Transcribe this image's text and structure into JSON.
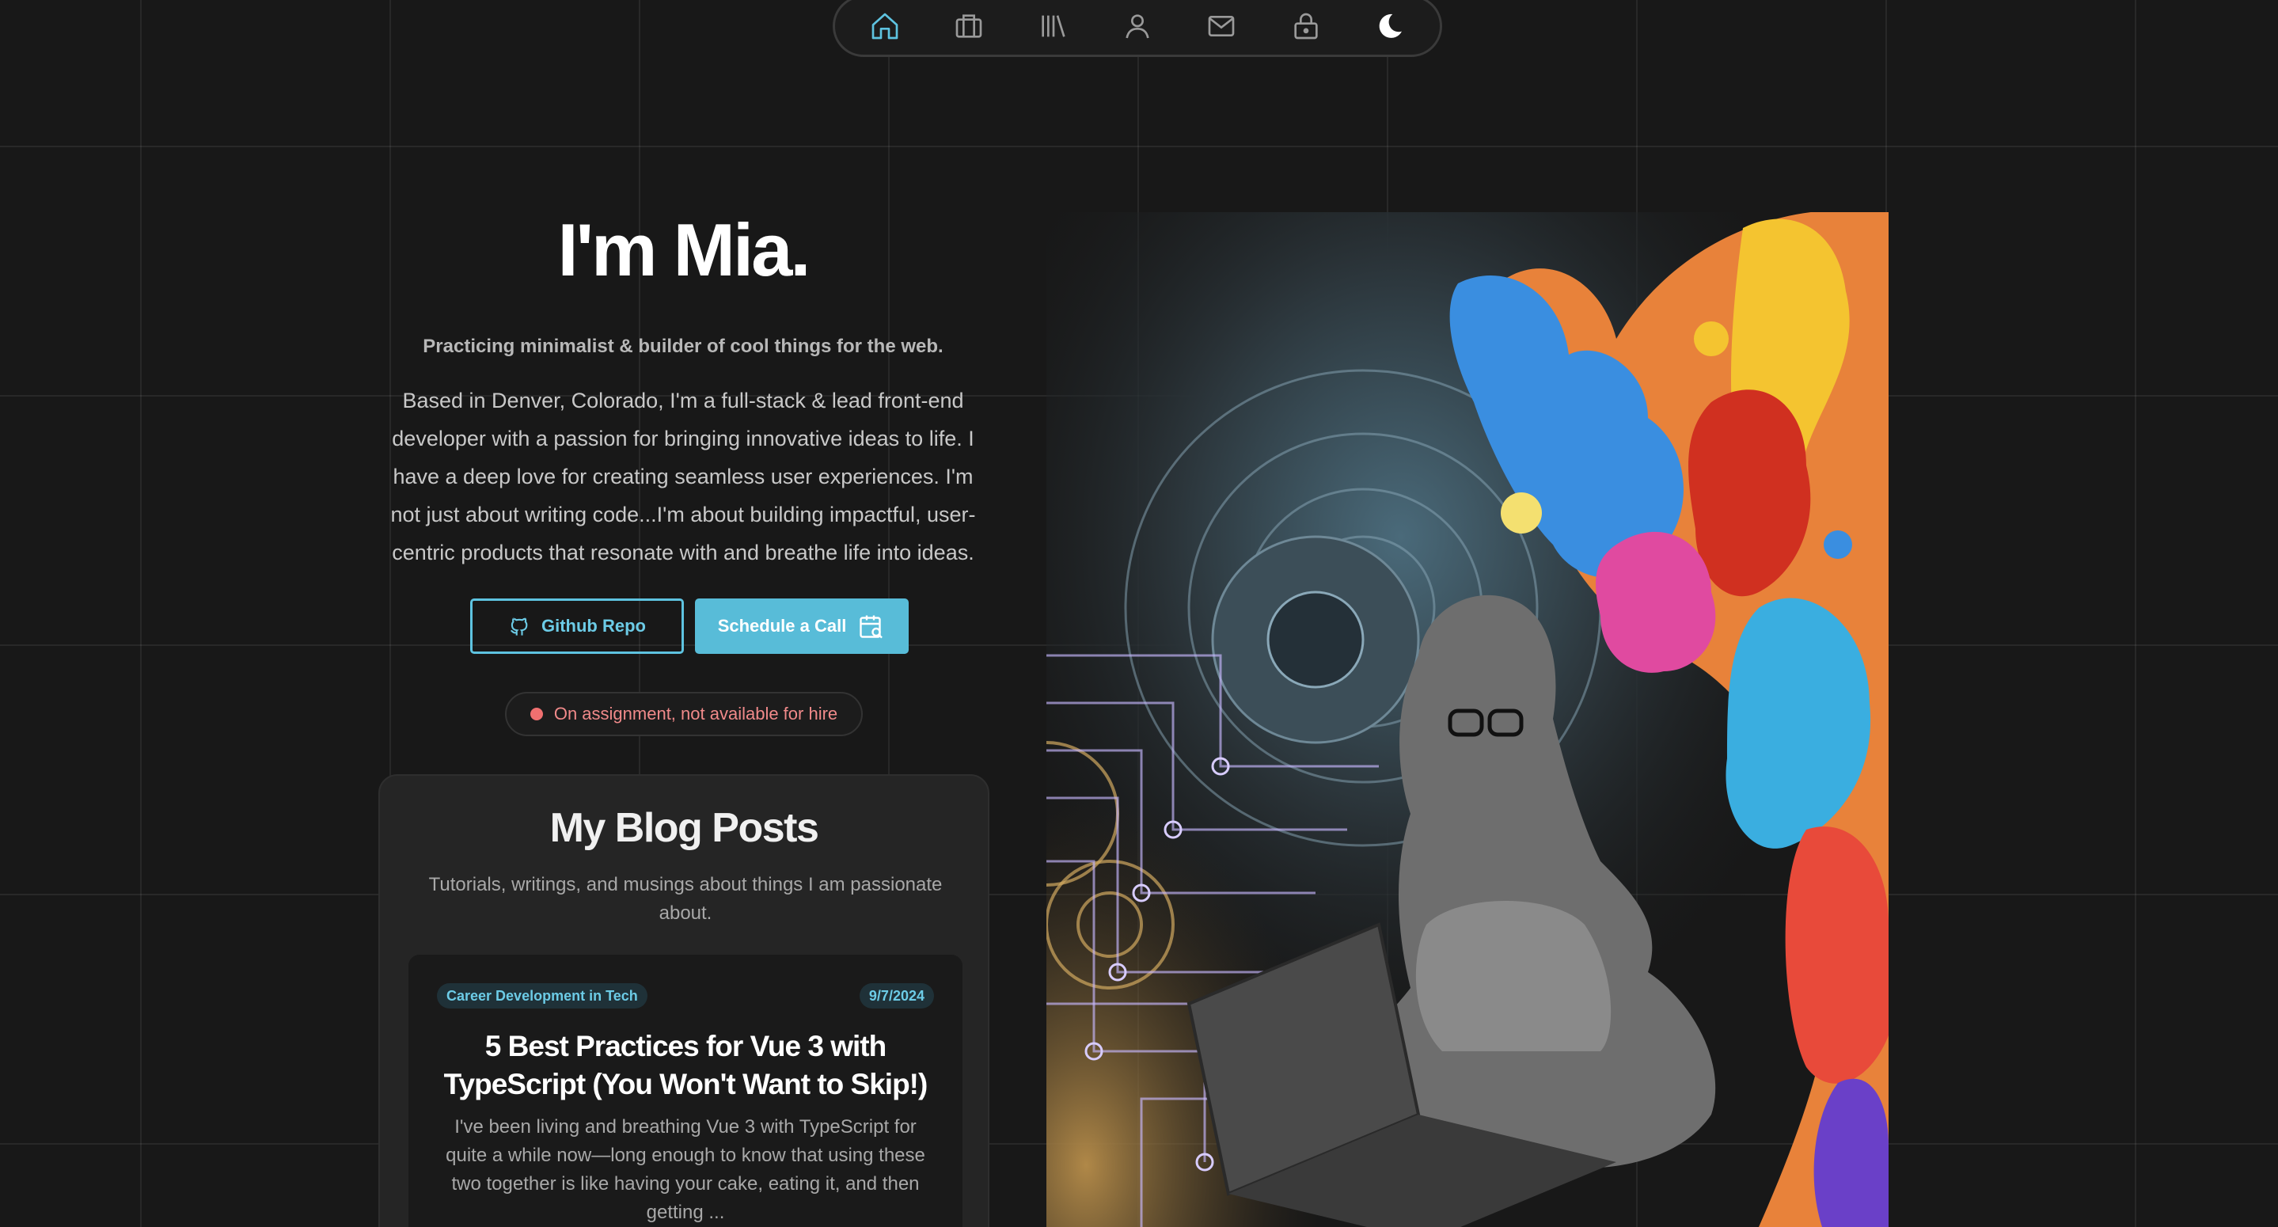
{
  "nav": {
    "items": [
      {
        "name": "home",
        "icon": "home-icon",
        "active": true
      },
      {
        "name": "portfolio",
        "icon": "briefcase-icon"
      },
      {
        "name": "library",
        "icon": "library-icon"
      },
      {
        "name": "about",
        "icon": "user-icon"
      },
      {
        "name": "contact",
        "icon": "mail-icon"
      },
      {
        "name": "private",
        "icon": "lock-icon"
      },
      {
        "name": "theme",
        "icon": "moon-icon"
      }
    ]
  },
  "hero": {
    "title": "I'm Mia.",
    "tagline": "Practicing minimalist & builder of cool things for the web.",
    "bio": "Based in Denver, Colorado, I'm a full-stack & lead front-end developer with a passion for bringing innovative ideas to life. I have a deep love for creating seamless user experiences. I'm not just about writing code...I'm about building impactful, user-centric products that resonate with and breathe life into ideas.",
    "github_label": "Github Repo",
    "schedule_label": "Schedule a Call",
    "status_text": "On assignment, not available for hire"
  },
  "blog": {
    "title": "My Blog Posts",
    "subtitle": "Tutorials, writings, and musings about things I am passionate about.",
    "posts": [
      {
        "category": "Career Development in Tech",
        "date": "9/7/2024",
        "title": "5 Best Practices for Vue 3 with TypeScript (You Won't Want to Skip!)",
        "excerpt": "I've been living and breathing Vue 3 with TypeScript for quite a while now—long enough to know that using these two together is like having your cake, eating it, and then getting ..."
      }
    ]
  },
  "colors": {
    "accent": "#58bcd8",
    "status": "#f07070",
    "background": "#181818"
  }
}
